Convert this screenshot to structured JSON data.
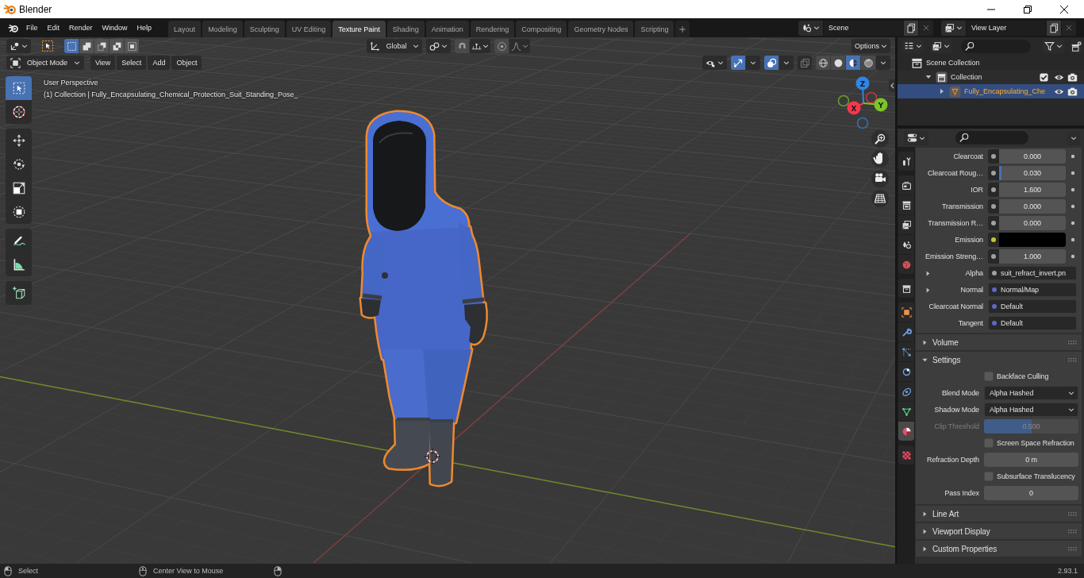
{
  "window": {
    "title": "Blender"
  },
  "menus": [
    "File",
    "Edit",
    "Render",
    "Window",
    "Help"
  ],
  "workspaces": [
    {
      "label": "Layout",
      "selected": false
    },
    {
      "label": "Modeling",
      "selected": false
    },
    {
      "label": "Sculpting",
      "selected": false
    },
    {
      "label": "UV Editing",
      "selected": false
    },
    {
      "label": "Texture Paint",
      "selected": true
    },
    {
      "label": "Shading",
      "selected": false
    },
    {
      "label": "Animation",
      "selected": false
    },
    {
      "label": "Rendering",
      "selected": false
    },
    {
      "label": "Compositing",
      "selected": false
    },
    {
      "label": "Geometry Nodes",
      "selected": false
    },
    {
      "label": "Scripting",
      "selected": false
    }
  ],
  "scene": {
    "name": "Scene"
  },
  "view_layer": {
    "name": "View Layer"
  },
  "viewport": {
    "select_modes": [
      {
        "kind": "set",
        "selected": true
      },
      {
        "kind": "extend",
        "selected": false
      },
      {
        "kind": "subtract",
        "selected": false
      },
      {
        "kind": "invert",
        "selected": false
      },
      {
        "kind": "intersect",
        "selected": false
      }
    ],
    "orientation": "Global",
    "options": "Options",
    "mode": "Object Mode",
    "menus": [
      "View",
      "Select",
      "Add",
      "Object"
    ],
    "gizmos_on": true,
    "overlays_on": true,
    "xray_on": false,
    "shading": [
      {
        "kind": "wireframe",
        "selected": false
      },
      {
        "kind": "solid",
        "selected": false
      },
      {
        "kind": "material",
        "selected": true
      },
      {
        "kind": "rendered",
        "selected": false
      }
    ],
    "tool_groups": [
      [
        {
          "kind": "select_box",
          "selected": true
        },
        {
          "kind": "cursor",
          "selected": false
        }
      ],
      [
        {
          "kind": "move",
          "selected": false
        },
        {
          "kind": "rotate",
          "selected": false
        },
        {
          "kind": "scale",
          "selected": false
        },
        {
          "kind": "transform",
          "selected": false
        }
      ],
      [
        {
          "kind": "annotate",
          "selected": false
        },
        {
          "kind": "measure",
          "selected": false
        }
      ],
      [
        {
          "kind": "add_cube",
          "selected": false
        }
      ]
    ],
    "view_name": "User Perspective",
    "object_info": "(1) Collection | Fully_Encapsulating_Chemical_Protection_Suit_Standing_Pose_",
    "axes": [
      {
        "label": "Z",
        "color": "#2e86e6"
      },
      {
        "label": "X",
        "color": "#f5374f"
      },
      {
        "label": "Y",
        "color": "#7cc526"
      }
    ]
  },
  "outliner": {
    "tree": [
      {
        "kind": "scene_collection",
        "label": "Scene Collection",
        "children": [
          {
            "kind": "collection",
            "label": "Collection",
            "expanded": true,
            "checked": true,
            "visible": true,
            "children": [
              {
                "kind": "mesh",
                "label": "Fully_Encapsulating_Che",
                "selected": true,
                "expanded": false,
                "visible": true
              }
            ]
          }
        ]
      }
    ]
  },
  "properties": {
    "tab_groups": [
      [
        {
          "kind": "tool",
          "selected": false
        }
      ],
      [
        {
          "kind": "render",
          "selected": false
        },
        {
          "kind": "output",
          "selected": false
        },
        {
          "kind": "view_layer",
          "selected": false
        },
        {
          "kind": "scene",
          "selected": false
        },
        {
          "kind": "world",
          "selected": false
        }
      ],
      [
        {
          "kind": "collection",
          "selected": false
        }
      ],
      [
        {
          "kind": "object",
          "selected": false
        },
        {
          "kind": "modifiers",
          "selected": false
        },
        {
          "kind": "particles",
          "selected": false
        },
        {
          "kind": "physics",
          "selected": false
        },
        {
          "kind": "constraints",
          "selected": false
        },
        {
          "kind": "data",
          "selected": false
        },
        {
          "kind": "material",
          "selected": true
        }
      ],
      [
        {
          "kind": "texture",
          "selected": false
        }
      ]
    ],
    "inputs": [
      {
        "kind": "number",
        "label": "Clearcoat",
        "value": "0.000",
        "color": "#a1a1a1"
      },
      {
        "kind": "slider",
        "label": "Clearcoat Roug…",
        "value": "0.030",
        "level": 0.03,
        "color": "#a1a1a1"
      },
      {
        "kind": "number",
        "label": "IOR",
        "value": "1.600",
        "color": "#a1a1a1"
      },
      {
        "kind": "number",
        "label": "Transmission",
        "value": "0.000",
        "color": "#a1a1a1"
      },
      {
        "kind": "number",
        "label": "Transmission R…",
        "value": "0.000",
        "color": "#a1a1a1"
      },
      {
        "kind": "color",
        "label": "Emission",
        "swatch": {
          "color": "#000000"
        },
        "color": "#c7c729"
      },
      {
        "kind": "number",
        "label": "Emission Streng…",
        "value": "1.000",
        "color": "#a1a1a1"
      },
      {
        "kind": "linked",
        "label": "Alpha",
        "value": "suit_refract_invert.pn",
        "color": "#a1a1a1"
      },
      {
        "kind": "linked",
        "label": "Normal",
        "value": "Normal/Map",
        "color": "#6363c7"
      },
      {
        "kind": "default",
        "label": "Clearcoat Normal",
        "value": "Default",
        "color": "#6363c7"
      },
      {
        "kind": "default",
        "label": "Tangent",
        "value": "Default",
        "color": "#6363c7"
      }
    ],
    "panels": [
      {
        "title": "Volume",
        "expanded": false
      },
      {
        "title": "Settings",
        "expanded": true,
        "rows": [
          {
            "kind": "checkbox",
            "label": "Backface Culling",
            "checked": false,
            "disabled": false
          },
          {
            "kind": "dropdown",
            "label": "Blend Mode",
            "value": "Alpha Hashed",
            "disabled": false
          },
          {
            "kind": "dropdown",
            "label": "Shadow Mode",
            "value": "Alpha Hashed",
            "disabled": false
          },
          {
            "kind": "slider",
            "label": "Clip Threshold",
            "value": "0.500",
            "level": 0.5,
            "disabled": true
          },
          {
            "kind": "checkbox",
            "label": "Screen Space Refraction",
            "checked": false,
            "disabled": false
          },
          {
            "kind": "number",
            "label": "Refraction Depth",
            "value": "0 m",
            "disabled": false
          },
          {
            "kind": "checkbox",
            "label": "Subsurface Translucency",
            "checked": false,
            "disabled": false
          },
          {
            "kind": "number",
            "label": "Pass Index",
            "value": "0",
            "disabled": false
          }
        ]
      },
      {
        "title": "Line Art",
        "expanded": false
      },
      {
        "title": "Viewport Display",
        "expanded": false
      },
      {
        "title": "Custom Properties",
        "expanded": false
      }
    ]
  },
  "status_bar": {
    "hints": [
      {
        "kind": "left",
        "label": "Select"
      },
      {
        "kind": "middle",
        "label": "Center View to Mouse"
      },
      {
        "kind": "right"
      }
    ],
    "version": "2.93.1"
  }
}
